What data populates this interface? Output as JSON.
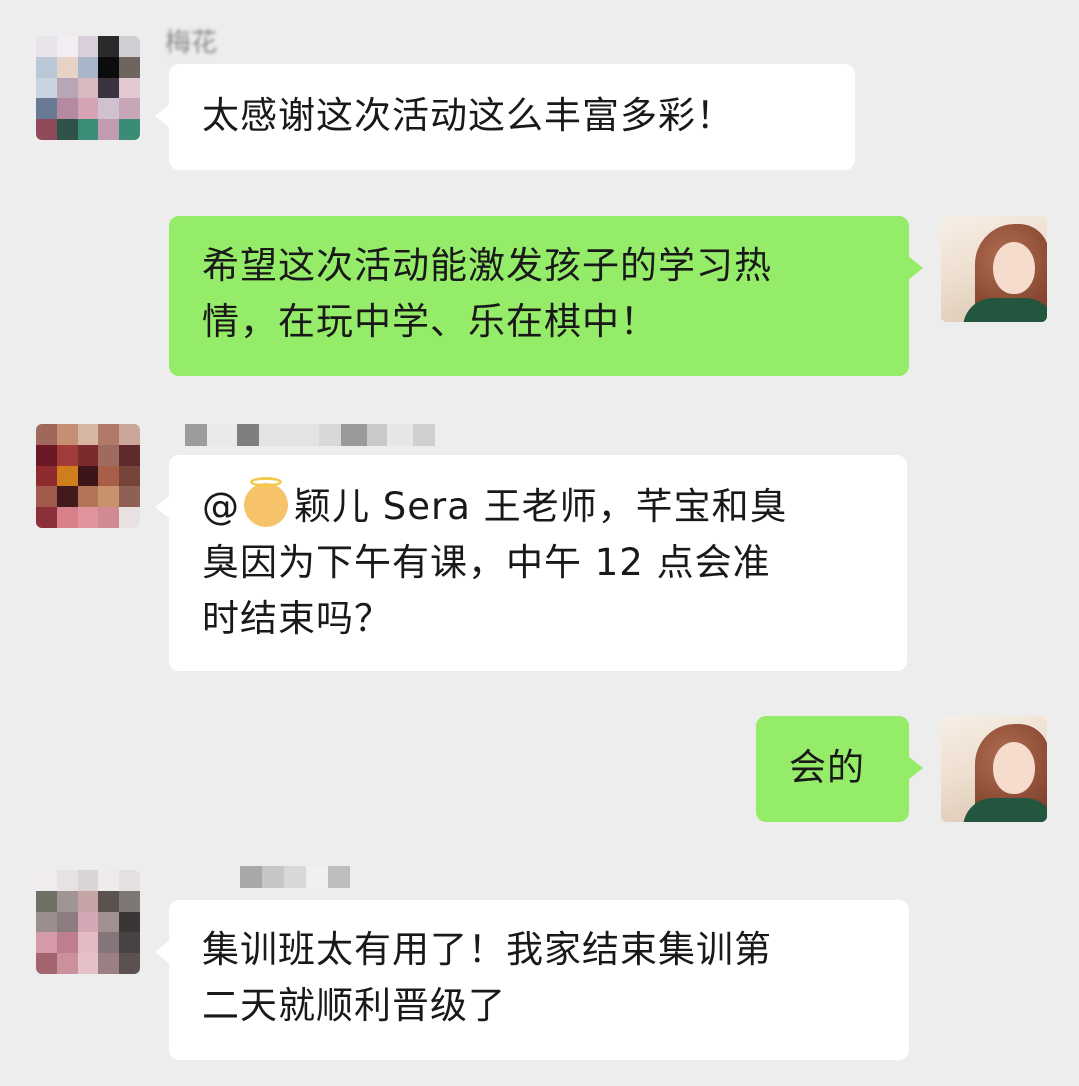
{
  "messages": [
    {
      "side": "in",
      "text": "太感谢这次活动这么丰富多彩！"
    },
    {
      "side": "out",
      "text_line1": "希望这次活动能激发孩子的学习热",
      "text_line2": "情，在玩中学、乐在棋中！"
    },
    {
      "side": "in",
      "mention": "@",
      "name_after_emoji": "颖儿 Sera 王老师，芊宝和臭",
      "text_line2": "臭因为下午有课，中午 12 点会准",
      "text_line3": "时结束吗？"
    },
    {
      "side": "out",
      "text": "会的"
    },
    {
      "side": "in",
      "text_line1": "集训班太有用了！我家结束集训第",
      "text_line2": "二天就顺利晋级了"
    }
  ],
  "sender_names": {
    "first_visible_fragment": "梅花"
  },
  "colors": {
    "background": "#ededed",
    "incoming_bubble": "#ffffff",
    "outgoing_bubble": "#95ec69"
  },
  "icons": {
    "mention_emoji": "baby-angel-emoji"
  }
}
